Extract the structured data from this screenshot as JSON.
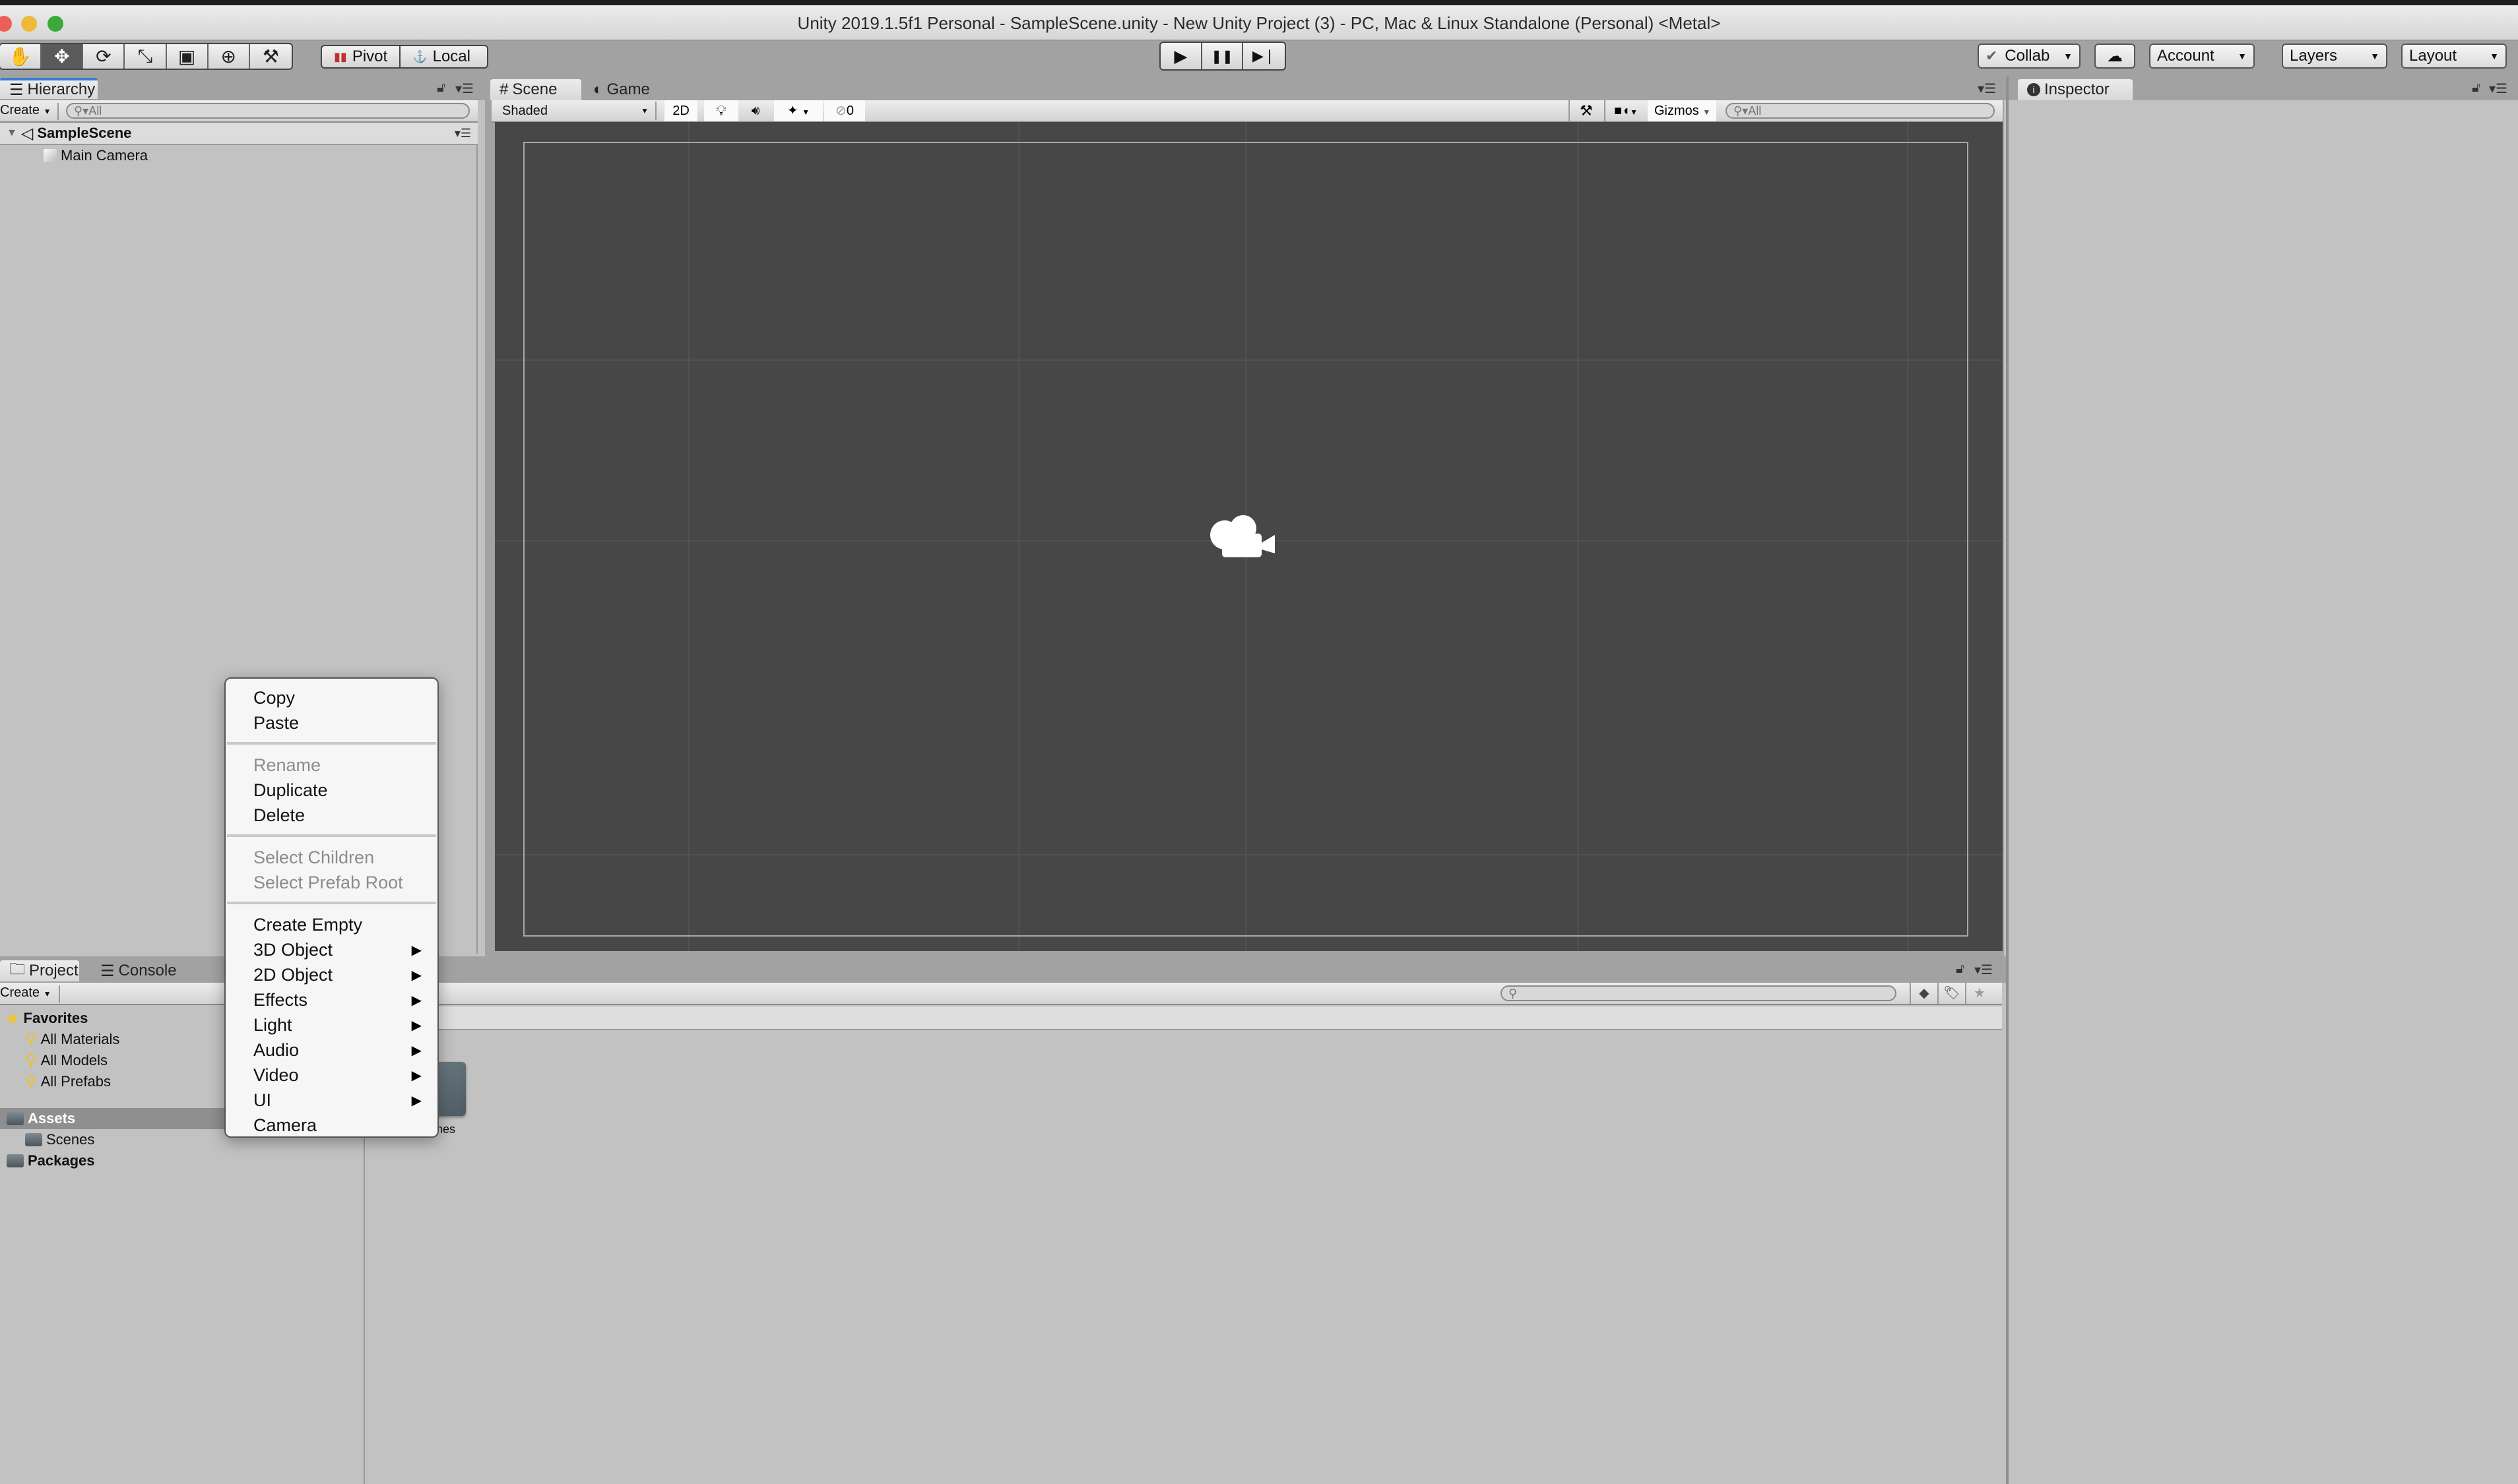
{
  "window": {
    "title": "Unity 2019.1.5f1 Personal - SampleScene.unity - New Unity Project (3) - PC, Mac & Linux Standalone (Personal) <Metal>",
    "traffic_lights": {
      "close": "#ec5f57",
      "minimize": "#f0b93a",
      "maximize": "#3ca93a"
    }
  },
  "toolbar": {
    "tools": [
      {
        "name": "hand-tool",
        "glyph": "✋",
        "active": false
      },
      {
        "name": "move-tool",
        "glyph": "✥",
        "active": true
      },
      {
        "name": "rotate-tool",
        "glyph": "⟳",
        "active": false
      },
      {
        "name": "scale-tool",
        "glyph": "⤡",
        "active": false
      },
      {
        "name": "rect-tool",
        "glyph": "▣",
        "active": false
      },
      {
        "name": "transform-tool",
        "glyph": "⊕",
        "active": false
      },
      {
        "name": "custom-tool",
        "glyph": "⚒",
        "active": false
      }
    ],
    "pivot_label": "Pivot",
    "local_label": "Local",
    "play_glyph": "▶",
    "pause_glyph": "❚❚",
    "step_glyph": "▶❘",
    "collab_label": "Collab",
    "cloud_glyph": "☁",
    "account_label": "Account",
    "layers_label": "Layers",
    "layout_label": "Layout"
  },
  "hierarchy": {
    "tab_label": "Hierarchy",
    "create_label": "Create",
    "search_placeholder": "All",
    "scene_name": "SampleScene",
    "items": [
      {
        "label": "Main Camera"
      }
    ]
  },
  "scene": {
    "tabs": [
      {
        "label": "Scene",
        "icon": "#"
      },
      {
        "label": "Game",
        "icon": "◐"
      }
    ],
    "shading_mode": "Shaded",
    "btn_2d": "2D",
    "hidden_count": "0",
    "gizmos_label": "Gizmos",
    "search_placeholder": "All"
  },
  "inspector": {
    "tab_label": "Inspector"
  },
  "project": {
    "tabs": [
      {
        "label": "Project"
      },
      {
        "label": "Console"
      }
    ],
    "create_label": "Create",
    "search_placeholder": "",
    "favorites_label": "Favorites",
    "favorites": [
      "All Materials",
      "All Models",
      "All Prefabs"
    ],
    "assets_label": "Assets",
    "assets_children": [
      "Scenes"
    ],
    "packages_label": "Packages",
    "grid_items": [
      {
        "label": "Scenes"
      }
    ]
  },
  "context_menu": {
    "groups": [
      [
        {
          "label": "Copy",
          "enabled": true
        },
        {
          "label": "Paste",
          "enabled": true
        }
      ],
      [
        {
          "label": "Rename",
          "enabled": false
        },
        {
          "label": "Duplicate",
          "enabled": true
        },
        {
          "label": "Delete",
          "enabled": true
        }
      ],
      [
        {
          "label": "Select Children",
          "enabled": false
        },
        {
          "label": "Select Prefab Root",
          "enabled": false
        }
      ],
      [
        {
          "label": "Create Empty",
          "enabled": true,
          "submenu": false
        },
        {
          "label": "3D Object",
          "enabled": true,
          "submenu": true
        },
        {
          "label": "2D Object",
          "enabled": true,
          "submenu": true
        },
        {
          "label": "Effects",
          "enabled": true,
          "submenu": true
        },
        {
          "label": "Light",
          "enabled": true,
          "submenu": true
        },
        {
          "label": "Audio",
          "enabled": true,
          "submenu": true
        },
        {
          "label": "Video",
          "enabled": true,
          "submenu": true
        },
        {
          "label": "UI",
          "enabled": true,
          "submenu": true
        },
        {
          "label": "Camera",
          "enabled": true,
          "submenu": false
        }
      ]
    ]
  }
}
